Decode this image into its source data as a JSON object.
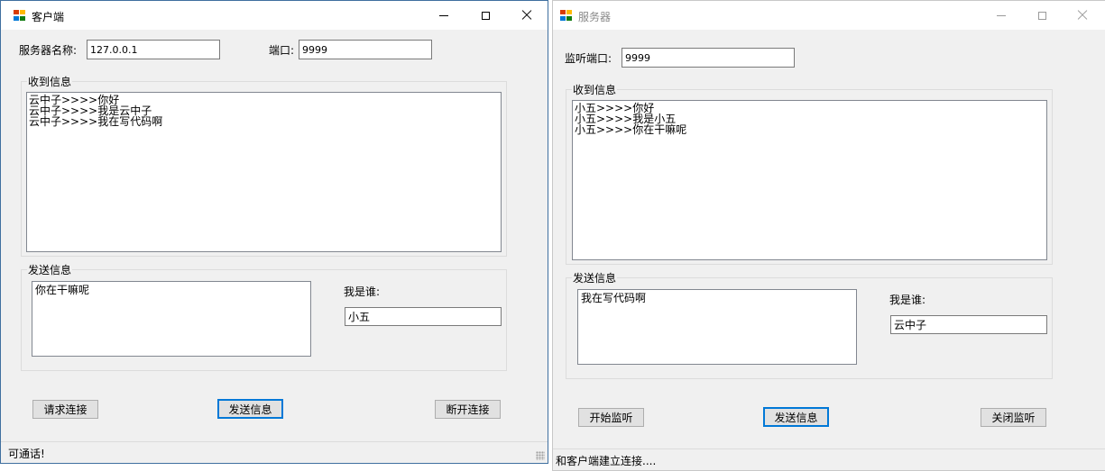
{
  "client": {
    "title": "客户端",
    "server_name_label": "服务器名称:",
    "server_name_value": "127.0.0.1",
    "port_label": "端口:",
    "port_value": "9999",
    "received_group": "收到信息",
    "received_lines": [
      "云中子>>>>你好",
      "云中子>>>>我是云中子",
      "云中子>>>>我在写代码啊"
    ],
    "send_group": "发送信息",
    "send_text": "你在干嘛呢",
    "whoami_label": "我是谁:",
    "whoami_value": "小五",
    "buttons": {
      "connect": "请求连接",
      "send": "发送信息",
      "disconnect": "断开连接"
    },
    "status": "可通话!"
  },
  "server": {
    "title": "服务器",
    "listen_port_label": "监听端口:",
    "listen_port_value": "9999",
    "received_group": "收到信息",
    "received_lines": [
      "小五>>>>你好",
      "小五>>>>我是小五",
      "小五>>>>你在干嘛呢"
    ],
    "send_group": "发送信息",
    "send_text": "我在写代码啊",
    "whoami_label": "我是谁:",
    "whoami_value": "云中子",
    "buttons": {
      "start": "开始监听",
      "send": "发送信息",
      "stop": "关闭监听"
    },
    "status": "和客户端建立连接...."
  },
  "colors": {
    "app_icon": [
      "#d83b01",
      "#ffb900",
      "#0078d7",
      "#107c10"
    ],
    "focus_border": "#0078d7"
  }
}
